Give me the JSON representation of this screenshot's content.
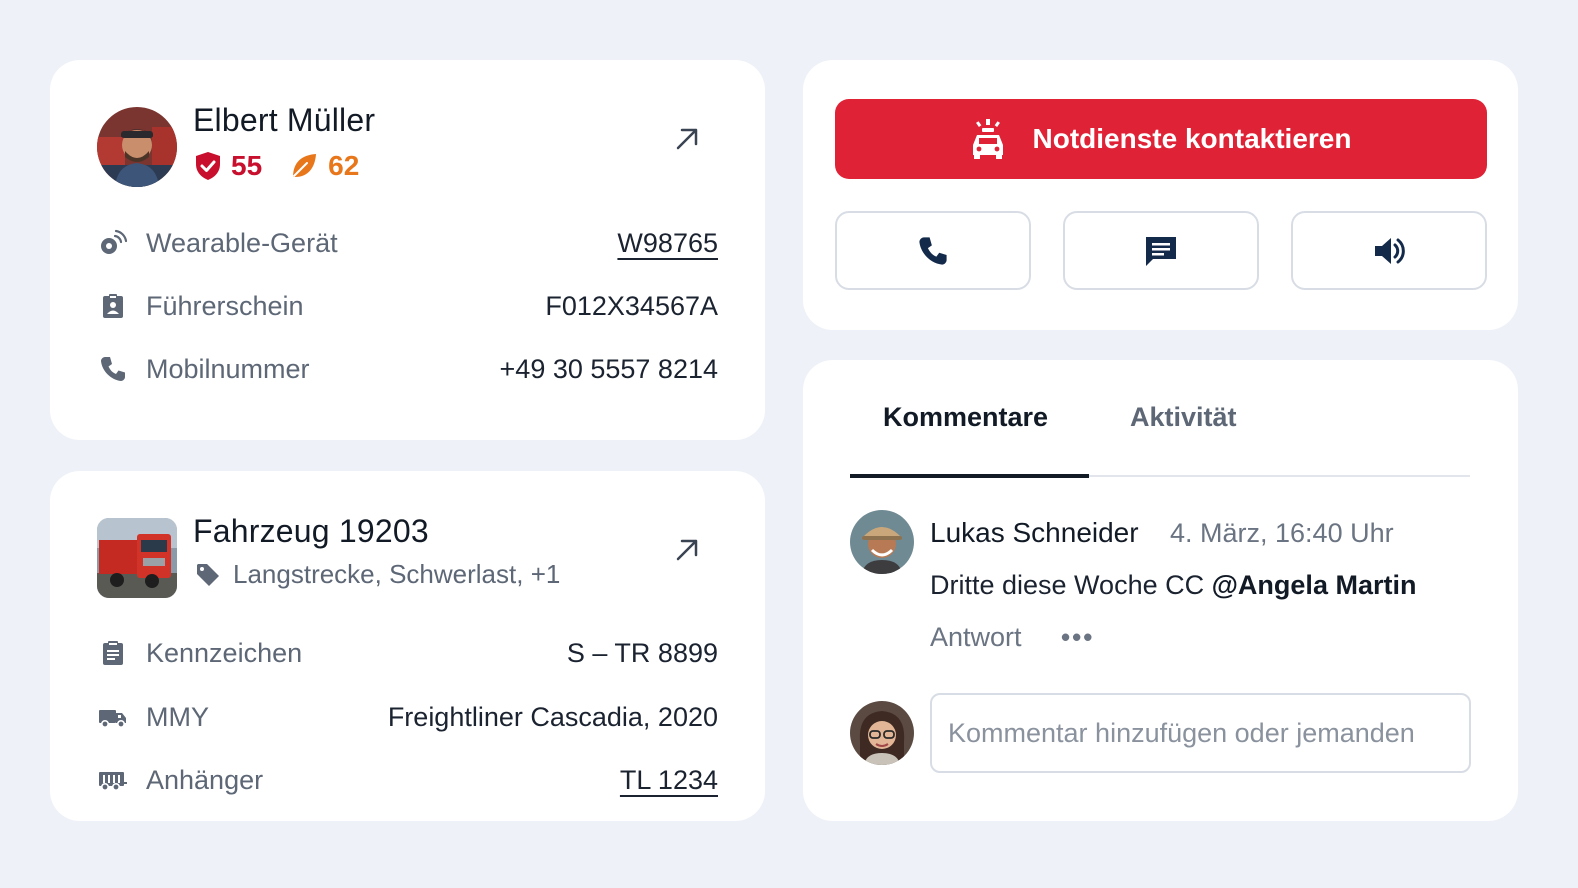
{
  "driver": {
    "name": "Elbert Müller",
    "safety_score": "55",
    "eco_score": "62",
    "rows": [
      {
        "icon": "wearable-icon",
        "label": "Wearable-Gerät",
        "value": "W98765"
      },
      {
        "icon": "license-icon",
        "label": "Führerschein",
        "value": "F012X34567A"
      },
      {
        "icon": "phone-icon",
        "label": "Mobilnummer",
        "value": "+49 30 5557 8214"
      }
    ]
  },
  "vehicle": {
    "name": "Fahrzeug 19203",
    "tags": "Langstrecke, Schwerlast, +1",
    "rows": [
      {
        "icon": "clipboard-icon",
        "label": "Kennzeichen",
        "value": "S – TR 8899"
      },
      {
        "icon": "truck-icon",
        "label": "MMY",
        "value": "Freightliner Cascadia, 2020"
      },
      {
        "icon": "trailer-icon",
        "label": "Anhänger",
        "value": "TL 1234"
      }
    ]
  },
  "contact": {
    "emergency_label": "Notdienste kontaktieren",
    "actions": [
      "phone-icon",
      "message-icon",
      "speaker-icon"
    ]
  },
  "comments": {
    "tabs": [
      "Kommentare",
      "Aktivität"
    ],
    "items": [
      {
        "author": "Lukas Schneider",
        "time": "4. März, 16:40 Uhr",
        "text": "Dritte diese Woche CC ",
        "mention": "@Angela Martin",
        "reply_label": "Antwort",
        "more": "•••"
      }
    ],
    "input_placeholder": "Kommentar hinzufügen oder jemanden"
  },
  "colors": {
    "accent_red": "#e02236",
    "safety_red": "#c8102e",
    "eco_orange": "#e8761a",
    "background": "#eef2f8"
  }
}
